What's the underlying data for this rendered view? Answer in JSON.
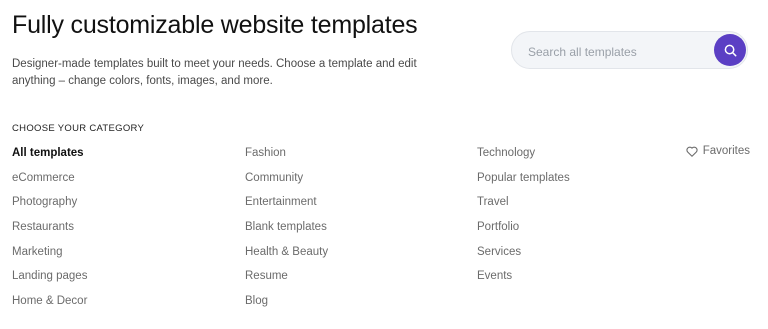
{
  "header": {
    "title": "Fully customizable website templates",
    "subtitle": "Designer-made templates built to meet your needs. Choose a template and edit anything – change colors, fonts, images, and more."
  },
  "search": {
    "placeholder": "Search all templates",
    "value": "",
    "button_icon": "search-icon",
    "accent_color": "#5b3fc4"
  },
  "categories": {
    "label": "CHOOSE YOUR CATEGORY",
    "columns": [
      [
        "All templates",
        "eCommerce",
        "Photography",
        "Restaurants",
        "Marketing",
        "Landing pages",
        "Home & Decor"
      ],
      [
        "Fashion",
        "Community",
        "Entertainment",
        "Blank templates",
        "Health & Beauty",
        "Resume",
        "Blog"
      ],
      [
        "Technology",
        "Popular templates",
        "Travel",
        "Portfolio",
        "Services",
        "Events"
      ]
    ],
    "active": "All templates"
  },
  "favorites": {
    "label": "Favorites",
    "icon": "heart-icon"
  }
}
